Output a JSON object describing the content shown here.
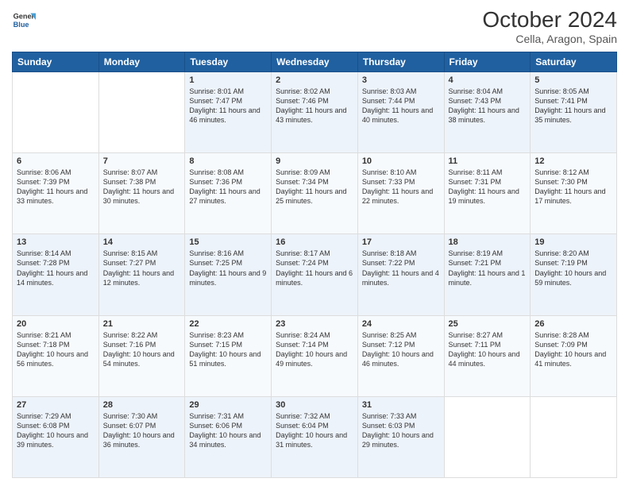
{
  "header": {
    "logo_line1": "General",
    "logo_line2": "Blue",
    "month_year": "October 2024",
    "location": "Cella, Aragon, Spain"
  },
  "days_of_week": [
    "Sunday",
    "Monday",
    "Tuesday",
    "Wednesday",
    "Thursday",
    "Friday",
    "Saturday"
  ],
  "weeks": [
    [
      {
        "day": "",
        "info": ""
      },
      {
        "day": "",
        "info": ""
      },
      {
        "day": "1",
        "info": "Sunrise: 8:01 AM\nSunset: 7:47 PM\nDaylight: 11 hours and 46 minutes."
      },
      {
        "day": "2",
        "info": "Sunrise: 8:02 AM\nSunset: 7:46 PM\nDaylight: 11 hours and 43 minutes."
      },
      {
        "day": "3",
        "info": "Sunrise: 8:03 AM\nSunset: 7:44 PM\nDaylight: 11 hours and 40 minutes."
      },
      {
        "day": "4",
        "info": "Sunrise: 8:04 AM\nSunset: 7:43 PM\nDaylight: 11 hours and 38 minutes."
      },
      {
        "day": "5",
        "info": "Sunrise: 8:05 AM\nSunset: 7:41 PM\nDaylight: 11 hours and 35 minutes."
      }
    ],
    [
      {
        "day": "6",
        "info": "Sunrise: 8:06 AM\nSunset: 7:39 PM\nDaylight: 11 hours and 33 minutes."
      },
      {
        "day": "7",
        "info": "Sunrise: 8:07 AM\nSunset: 7:38 PM\nDaylight: 11 hours and 30 minutes."
      },
      {
        "day": "8",
        "info": "Sunrise: 8:08 AM\nSunset: 7:36 PM\nDaylight: 11 hours and 27 minutes."
      },
      {
        "day": "9",
        "info": "Sunrise: 8:09 AM\nSunset: 7:34 PM\nDaylight: 11 hours and 25 minutes."
      },
      {
        "day": "10",
        "info": "Sunrise: 8:10 AM\nSunset: 7:33 PM\nDaylight: 11 hours and 22 minutes."
      },
      {
        "day": "11",
        "info": "Sunrise: 8:11 AM\nSunset: 7:31 PM\nDaylight: 11 hours and 19 minutes."
      },
      {
        "day": "12",
        "info": "Sunrise: 8:12 AM\nSunset: 7:30 PM\nDaylight: 11 hours and 17 minutes."
      }
    ],
    [
      {
        "day": "13",
        "info": "Sunrise: 8:14 AM\nSunset: 7:28 PM\nDaylight: 11 hours and 14 minutes."
      },
      {
        "day": "14",
        "info": "Sunrise: 8:15 AM\nSunset: 7:27 PM\nDaylight: 11 hours and 12 minutes."
      },
      {
        "day": "15",
        "info": "Sunrise: 8:16 AM\nSunset: 7:25 PM\nDaylight: 11 hours and 9 minutes."
      },
      {
        "day": "16",
        "info": "Sunrise: 8:17 AM\nSunset: 7:24 PM\nDaylight: 11 hours and 6 minutes."
      },
      {
        "day": "17",
        "info": "Sunrise: 8:18 AM\nSunset: 7:22 PM\nDaylight: 11 hours and 4 minutes."
      },
      {
        "day": "18",
        "info": "Sunrise: 8:19 AM\nSunset: 7:21 PM\nDaylight: 11 hours and 1 minute."
      },
      {
        "day": "19",
        "info": "Sunrise: 8:20 AM\nSunset: 7:19 PM\nDaylight: 10 hours and 59 minutes."
      }
    ],
    [
      {
        "day": "20",
        "info": "Sunrise: 8:21 AM\nSunset: 7:18 PM\nDaylight: 10 hours and 56 minutes."
      },
      {
        "day": "21",
        "info": "Sunrise: 8:22 AM\nSunset: 7:16 PM\nDaylight: 10 hours and 54 minutes."
      },
      {
        "day": "22",
        "info": "Sunrise: 8:23 AM\nSunset: 7:15 PM\nDaylight: 10 hours and 51 minutes."
      },
      {
        "day": "23",
        "info": "Sunrise: 8:24 AM\nSunset: 7:14 PM\nDaylight: 10 hours and 49 minutes."
      },
      {
        "day": "24",
        "info": "Sunrise: 8:25 AM\nSunset: 7:12 PM\nDaylight: 10 hours and 46 minutes."
      },
      {
        "day": "25",
        "info": "Sunrise: 8:27 AM\nSunset: 7:11 PM\nDaylight: 10 hours and 44 minutes."
      },
      {
        "day": "26",
        "info": "Sunrise: 8:28 AM\nSunset: 7:09 PM\nDaylight: 10 hours and 41 minutes."
      }
    ],
    [
      {
        "day": "27",
        "info": "Sunrise: 7:29 AM\nSunset: 6:08 PM\nDaylight: 10 hours and 39 minutes."
      },
      {
        "day": "28",
        "info": "Sunrise: 7:30 AM\nSunset: 6:07 PM\nDaylight: 10 hours and 36 minutes."
      },
      {
        "day": "29",
        "info": "Sunrise: 7:31 AM\nSunset: 6:06 PM\nDaylight: 10 hours and 34 minutes."
      },
      {
        "day": "30",
        "info": "Sunrise: 7:32 AM\nSunset: 6:04 PM\nDaylight: 10 hours and 31 minutes."
      },
      {
        "day": "31",
        "info": "Sunrise: 7:33 AM\nSunset: 6:03 PM\nDaylight: 10 hours and 29 minutes."
      },
      {
        "day": "",
        "info": ""
      },
      {
        "day": "",
        "info": ""
      }
    ]
  ]
}
